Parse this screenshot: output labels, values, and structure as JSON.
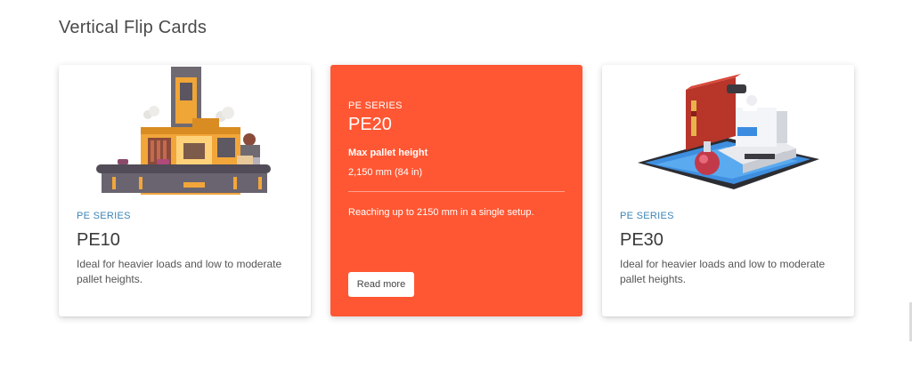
{
  "section": {
    "title": "Vertical Flip Cards"
  },
  "cards": [
    {
      "series": "PE SERIES",
      "model": "PE10",
      "description": "Ideal for heavier loads and low to moderate pallet heights.",
      "image": "factory-machine-illustration"
    },
    {
      "series": "PE SERIES",
      "model": "PE20",
      "spec_label": "Max pallet height",
      "spec_value": "2,150 mm (84 in)",
      "detail": "Reaching up to 2150 mm in a single setup.",
      "button_label": "Read more",
      "background": "#ff5733"
    },
    {
      "series": "PE SERIES",
      "model": "PE30",
      "description": "Ideal for heavier loads and low to moderate pallet heights.",
      "image": "laboratory-microscope-illustration"
    }
  ],
  "colors": {
    "accent": "#ff5733",
    "series_label": "#3d84b8",
    "heading": "#4a4a4a"
  }
}
